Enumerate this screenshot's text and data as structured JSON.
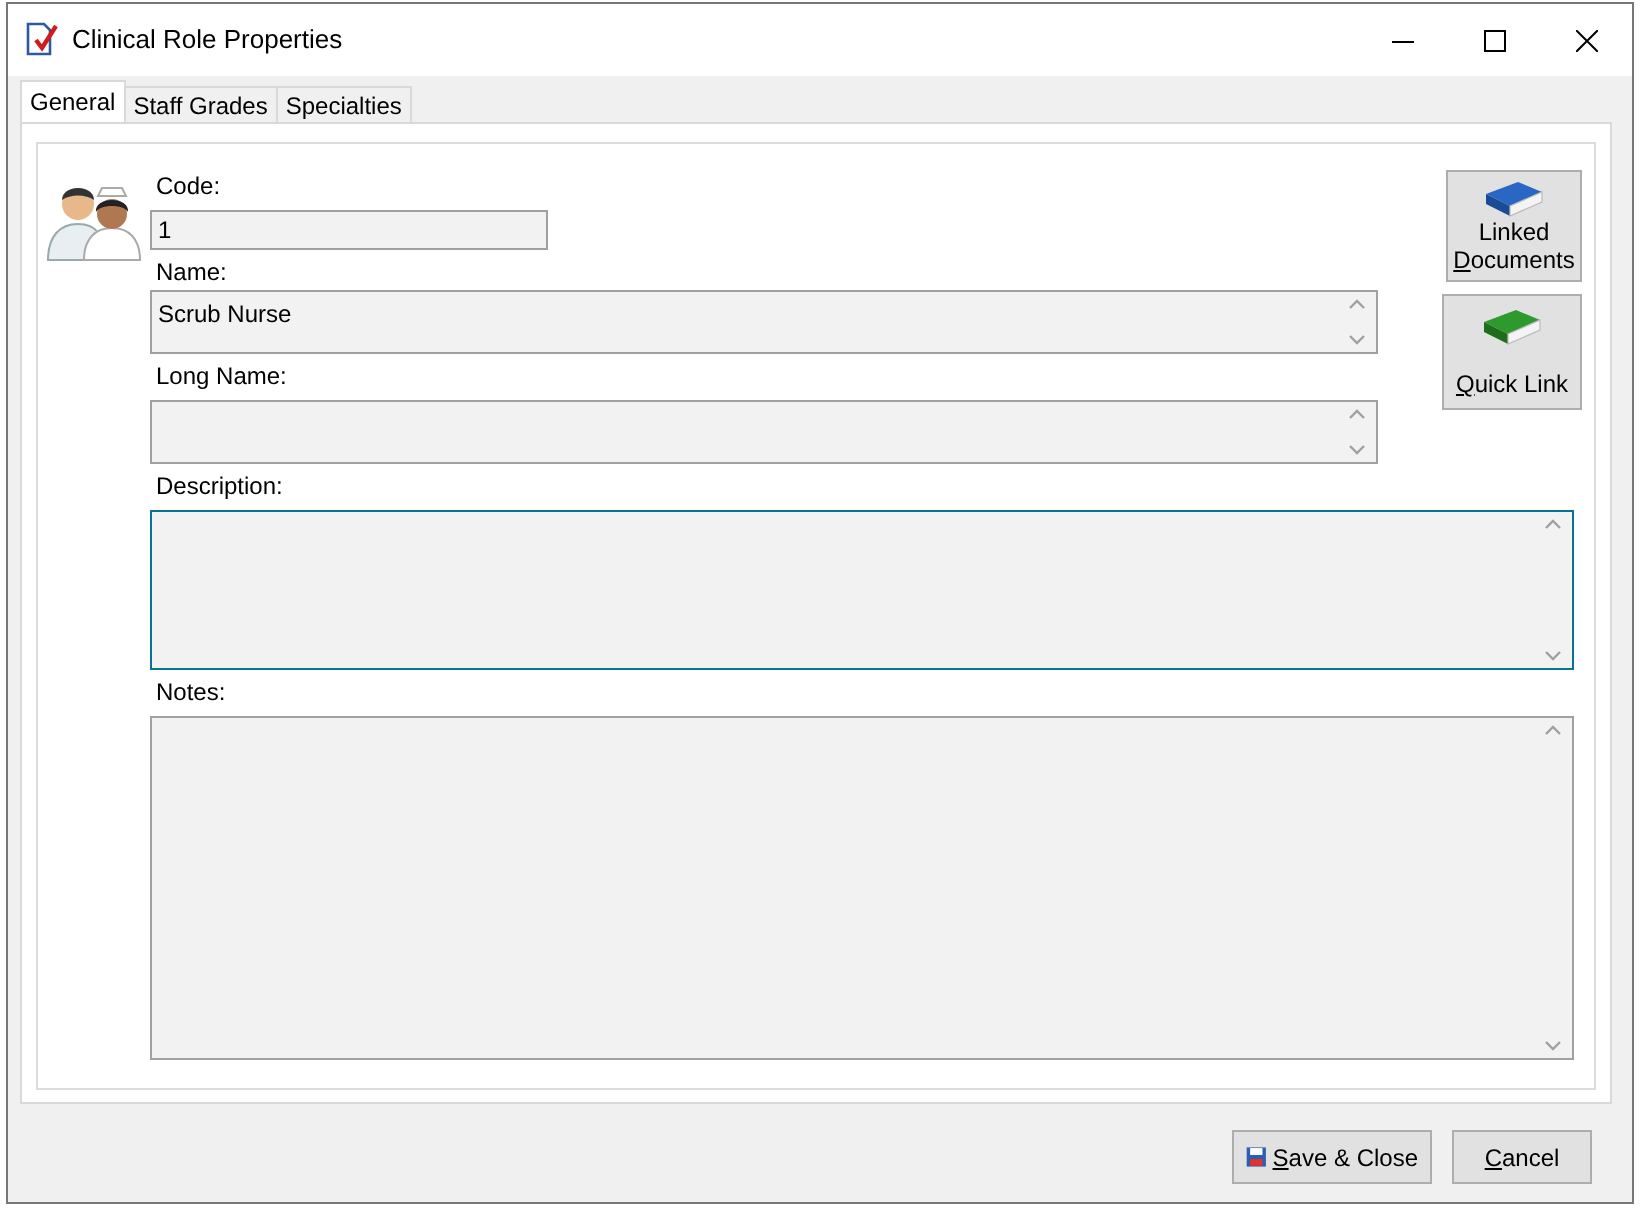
{
  "window": {
    "title": "Clinical Role Properties"
  },
  "tabs": [
    {
      "label": "General",
      "selected": true
    },
    {
      "label": "Staff Grades",
      "selected": false
    },
    {
      "label": "Specialties",
      "selected": false
    }
  ],
  "fields": [
    {
      "kind": "line",
      "label": "Code:",
      "value": "1",
      "focused": false
    },
    {
      "kind": "narrow-box",
      "label": "Name:",
      "value": "Scrub Nurse",
      "focused": false
    },
    {
      "kind": "narrow-box",
      "label": "Long Name:",
      "focused": false
    },
    {
      "kind": "wide-box",
      "label": "Description:",
      "focused": true
    },
    {
      "kind": "fill-box",
      "label": "Notes:",
      "focused": false
    }
  ],
  "side_buttons": [
    {
      "kind": "blue-book",
      "lines": [
        "Linked",
        "Documents"
      ]
    },
    {
      "kind": "green-book",
      "lines": [
        "Quick Link"
      ]
    }
  ],
  "footer_buttons": [
    {
      "kind": "save",
      "label": "Save & Close"
    },
    {
      "kind": "plain",
      "label": "Cancel"
    }
  ]
}
